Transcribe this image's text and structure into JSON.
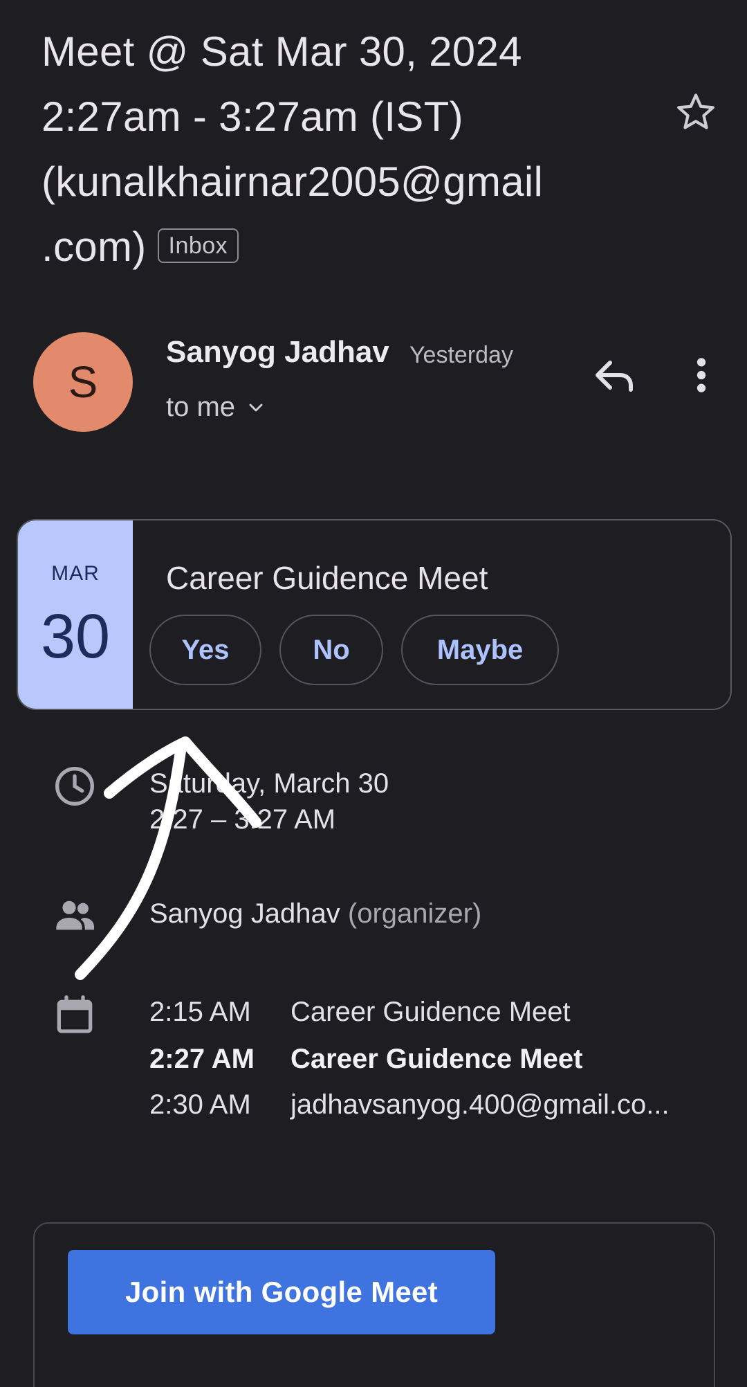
{
  "email": {
    "subject_lines": [
      "Meet @ Sat Mar 30, 2024",
      "2:27am - 3:27am (IST)",
      "(kunalkhairnar2005@gmail",
      ".com)"
    ],
    "label_chip": "Inbox",
    "starred": false
  },
  "sender": {
    "avatar_letter": "S",
    "avatar_color": "#e38a6d",
    "name": "Sanyog Jadhav",
    "time": "Yesterday",
    "recipient": "to me"
  },
  "invite": {
    "month": "MAR",
    "day": "30",
    "title": "Career Guidence Meet",
    "rsvp": {
      "yes": "Yes",
      "no": "No",
      "maybe": "Maybe"
    }
  },
  "details": {
    "date": "Saturday, March 30",
    "time_range": "2:27 – 3:27 AM",
    "organizer_name": "Sanyog Jadhav",
    "organizer_role": "(organizer)"
  },
  "schedule": [
    {
      "time": "2:15 AM",
      "title": "Career Guidence Meet",
      "current": false
    },
    {
      "time": "2:27 AM",
      "title": "Career Guidence Meet",
      "current": true
    },
    {
      "time": "2:30 AM",
      "title": "jadhavsanyog.400@gmail.co...",
      "current": false
    }
  ],
  "meet": {
    "join_label": "Join with Google Meet",
    "button_color": "#3e73e0"
  },
  "icons": {
    "star": "star-outline-icon",
    "reply": "reply-icon",
    "more": "more-vert-icon",
    "clock": "clock-icon",
    "people": "people-icon",
    "calendar": "calendar-icon",
    "chevron": "chevron-down-icon"
  }
}
